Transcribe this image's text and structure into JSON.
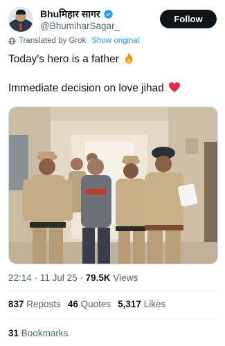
{
  "header": {
    "display_name": "Bhuमिहार सागर",
    "handle": "@BhumiharSagar_",
    "follow_label": "Follow"
  },
  "translation": {
    "label": "Translated by Grok",
    "show_original": "Show original"
  },
  "tweet": {
    "line1": "Today's hero is a father",
    "line2": "Immediate decision on love jihad"
  },
  "meta": {
    "time": "22:14",
    "date": "11 Jul 25",
    "views_count": "79.5K",
    "views_label": "Views"
  },
  "stats": {
    "reposts_count": "837",
    "reposts_label": "Reposts",
    "quotes_count": "46",
    "quotes_label": "Quotes",
    "likes_count": "5,317",
    "likes_label": "Likes",
    "bookmarks_count": "31",
    "bookmarks_label": "Bookmarks"
  },
  "colors": {
    "accent": "#1d9bf0",
    "text": "#0f1419",
    "muted": "#536471",
    "fire": "#f4900c",
    "heart": "#dd2e44"
  }
}
